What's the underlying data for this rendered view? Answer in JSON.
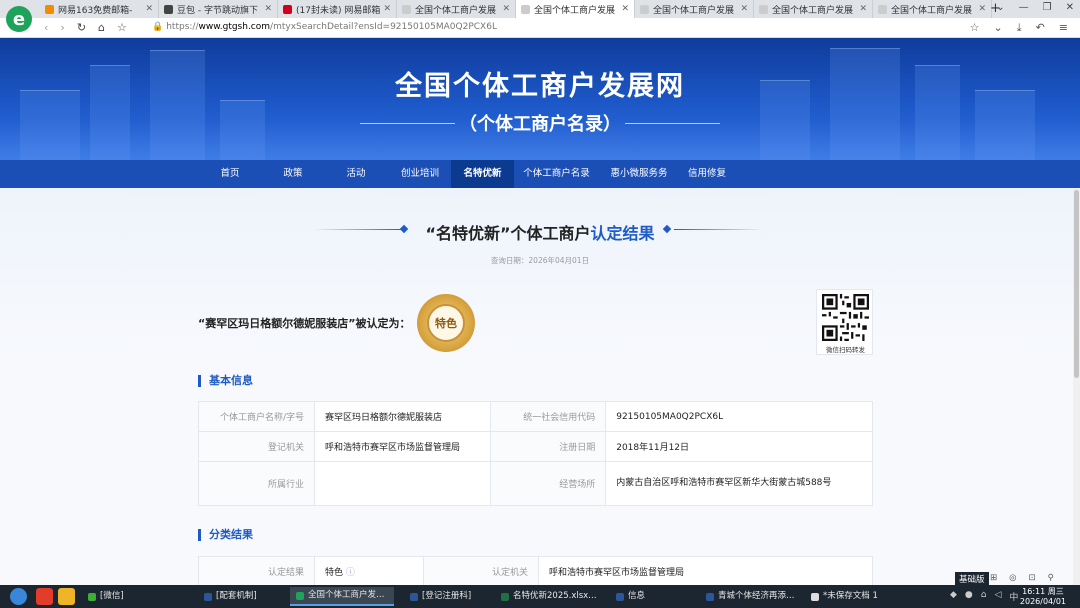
{
  "browser": {
    "tabs": [
      {
        "title": "网易163免费邮箱-",
        "fav": "#f08c00",
        "active": false
      },
      {
        "title": "豆包 - 字节跳动旗下",
        "fav": "#444444",
        "active": false
      },
      {
        "title": "(17封未读) 网易邮箱",
        "fav": "#d0021b",
        "active": false
      },
      {
        "title": "全国个体工商户发展",
        "fav": "#cccccc",
        "active": false
      },
      {
        "title": "全国个体工商户发展",
        "fav": "#cccccc",
        "active": true
      },
      {
        "title": "全国个体工商户发展",
        "fav": "#cccccc",
        "active": false
      },
      {
        "title": "全国个体工商户发展",
        "fav": "#cccccc",
        "active": false
      },
      {
        "title": "全国个体工商户发展",
        "fav": "#cccccc",
        "active": false
      }
    ],
    "url_scheme": "https://",
    "url_host": "www.gtgsh.com",
    "url_path": "/mtyxSearchDetail?ensId=92150105MA0Q2PCX6L"
  },
  "site": {
    "title": "全国个体工商户发展网",
    "subtitle": "（个体工商户名录）",
    "nav": [
      {
        "label": "首页",
        "active": false
      },
      {
        "label": "政策",
        "active": false
      },
      {
        "label": "活动",
        "active": false
      },
      {
        "label": "创业培训",
        "active": false
      },
      {
        "label": "名特优新",
        "active": true
      },
      {
        "label": "个体工商户名录",
        "active": false
      },
      {
        "label": "惠小微服务务",
        "active": false
      },
      {
        "label": "信用修复",
        "active": false
      }
    ]
  },
  "result": {
    "heading_prefix": "“名特优新”个体工商户",
    "heading_highlight": "认定结果",
    "query_date": "查询日期：2026年04月01日",
    "certified_text": "“赛罕区玛日格额尔德妮服装店”被认定为：",
    "badge_text": "特色",
    "qr_caption": "微信扫码转发"
  },
  "basic_info": {
    "title": "基本信息",
    "rows": [
      {
        "k1": "个体工商户名称/字号",
        "v1": "赛罕区玛日格额尔德妮服装店",
        "k2": "统一社会信用代码",
        "v2": "92150105MA0Q2PCX6L"
      },
      {
        "k1": "登记机关",
        "v1": "呼和浩特市赛罕区市场监督管理局",
        "k2": "注册日期",
        "v2": "2018年11月12日"
      },
      {
        "k1": "所属行业",
        "v1": "",
        "k2": "经营场所",
        "v2": "内蒙古自治区呼和浩特市赛罕区新华大街蒙古城588号"
      }
    ]
  },
  "classification": {
    "title": "分类结果",
    "row": {
      "k1": "认定结果",
      "v1": "特色",
      "k2": "认定机关",
      "v2": "呼和浩特市赛罕区市场监督管理局"
    }
  },
  "taskbar": {
    "items": [
      {
        "label": "[微信]",
        "color": "#3cb034",
        "active": false
      },
      {
        "label": "[配套机制]",
        "color": "#2b579a",
        "active": false
      },
      {
        "label": "全国个体工商户发…",
        "color": "#1fa35a",
        "active": true
      },
      {
        "label": "[登记注册科]",
        "color": "#2b579a",
        "active": false
      },
      {
        "label": "名特优新2025.xlsx…",
        "color": "#1e7145",
        "active": false
      },
      {
        "label": "信息",
        "color": "#2b579a",
        "active": false
      },
      {
        "label": "青城个体经济再添…",
        "color": "#2b579a",
        "active": false
      },
      {
        "label": "*未保存文档 1",
        "color": "#dddddd",
        "active": false
      }
    ],
    "basic_version": "基础版",
    "time": "16:11 周三",
    "date": "2026/04/01"
  }
}
